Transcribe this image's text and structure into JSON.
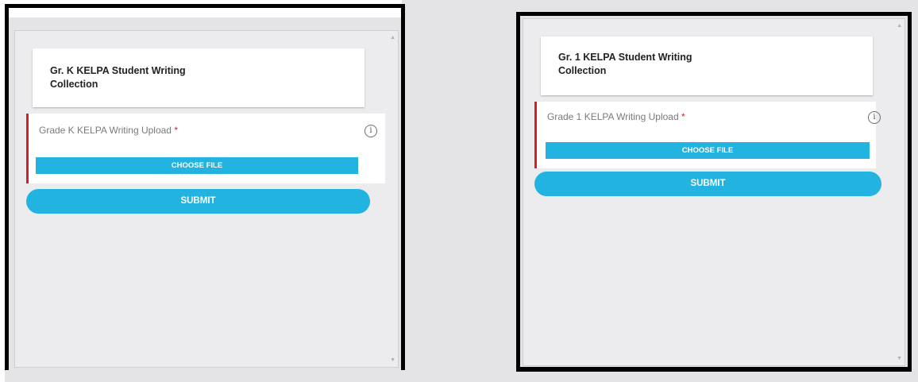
{
  "panels": [
    {
      "card_title": "Gr. K KELPA Student Writing Collection",
      "field_label": "Grade K KELPA Writing Upload",
      "required_mark": "*",
      "choose_file_label": "CHOOSE FILE",
      "submit_label": "SUBMIT",
      "info_glyph": "i"
    },
    {
      "card_title": "Gr. 1 KELPA Student Writing Collection",
      "field_label": "Grade 1 KELPA Writing Upload",
      "required_mark": "*",
      "choose_file_label": "CHOOSE FILE",
      "submit_label": "SUBMIT",
      "info_glyph": "i"
    }
  ],
  "scroll": {
    "up_glyph": "▲",
    "down_glyph": "▼"
  },
  "colors": {
    "accent": "#22b3e0",
    "required": "#d2202a",
    "panel_bg": "#ececee",
    "frame": "#000000"
  }
}
